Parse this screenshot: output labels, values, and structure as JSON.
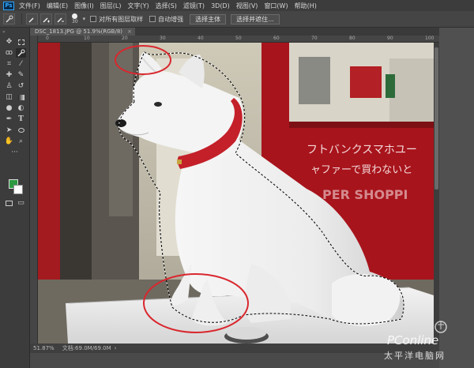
{
  "app": {
    "logo": "Ps"
  },
  "menu": [
    "文件(F)",
    "编辑(E)",
    "图像(I)",
    "图层(L)",
    "文字(Y)",
    "选择(S)",
    "滤镜(T)",
    "3D(D)",
    "视图(V)",
    "窗口(W)",
    "帮助(H)"
  ],
  "options": {
    "brush_size": "30",
    "sample_all_layers": "对所有图层取样",
    "auto_enhance": "自动增强",
    "select_subject": "选择主体",
    "select_and_mask": "选择并遮住..."
  },
  "document": {
    "tab_title": "DSC_1813.JPG @ 51.9%(RGB/8)",
    "close": "×"
  },
  "ruler": {
    "top_ticks": [
      "0",
      "10",
      "20",
      "30",
      "40",
      "50",
      "60",
      "70",
      "80",
      "90",
      "100"
    ]
  },
  "status": {
    "zoom": "51.87%",
    "doc_size": "文档:69.0M/69.0M"
  },
  "colors": {
    "foreground": "#2c9a41",
    "background": "#ffffff",
    "annotation": "#d9272e"
  },
  "watermark": {
    "brand": "PConline",
    "site": "太平洋电脑网"
  },
  "icons": {
    "move": "move-icon",
    "marquee": "rect-marquee-icon",
    "lasso": "lasso-icon",
    "quick_select": "quick-select-icon",
    "crop": "crop-icon",
    "eyedropper": "eyedropper-icon",
    "healing": "healing-brush-icon",
    "brush": "brush-icon",
    "stamp": "clone-stamp-icon",
    "history": "history-brush-icon",
    "eraser": "eraser-icon",
    "gradient": "gradient-icon",
    "blur": "blur-icon",
    "dodge": "dodge-icon",
    "pen": "pen-icon",
    "type": "type-icon",
    "path_select": "path-select-icon",
    "shape": "ellipse-shape-icon",
    "hand": "hand-icon",
    "zoom": "zoom-icon",
    "more": "more-tools-icon"
  }
}
